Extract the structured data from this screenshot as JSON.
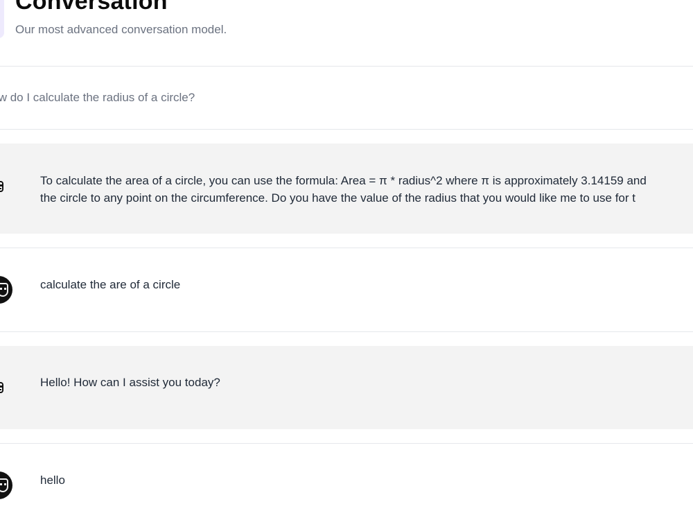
{
  "header": {
    "title": "Conversation",
    "subtitle": "Our most advanced conversation model."
  },
  "prompt": {
    "placeholder": "How do I calculate the radius of a circle?"
  },
  "messages": [
    {
      "role": "assistant",
      "avatar": "robot-avatar",
      "lines": [
        "To calculate the area of a circle, you can use the formula: Area = π * radius^2 where π is approximately 3.14159 and",
        "the circle to any point on the circumference. Do you have the value of the radius that you would like me to use for t"
      ]
    },
    {
      "role": "user",
      "avatar": "user-avatar",
      "text": "calculate the are of a circle"
    },
    {
      "role": "assistant",
      "avatar": "robot-avatar",
      "text": "Hello! How can I assist you today?"
    },
    {
      "role": "user",
      "avatar": "user-avatar",
      "text": "hello"
    }
  ],
  "colors": {
    "assistant_bg": "#f3f3f3",
    "divider": "#e5e7eb",
    "subtitle": "#6b7280"
  }
}
